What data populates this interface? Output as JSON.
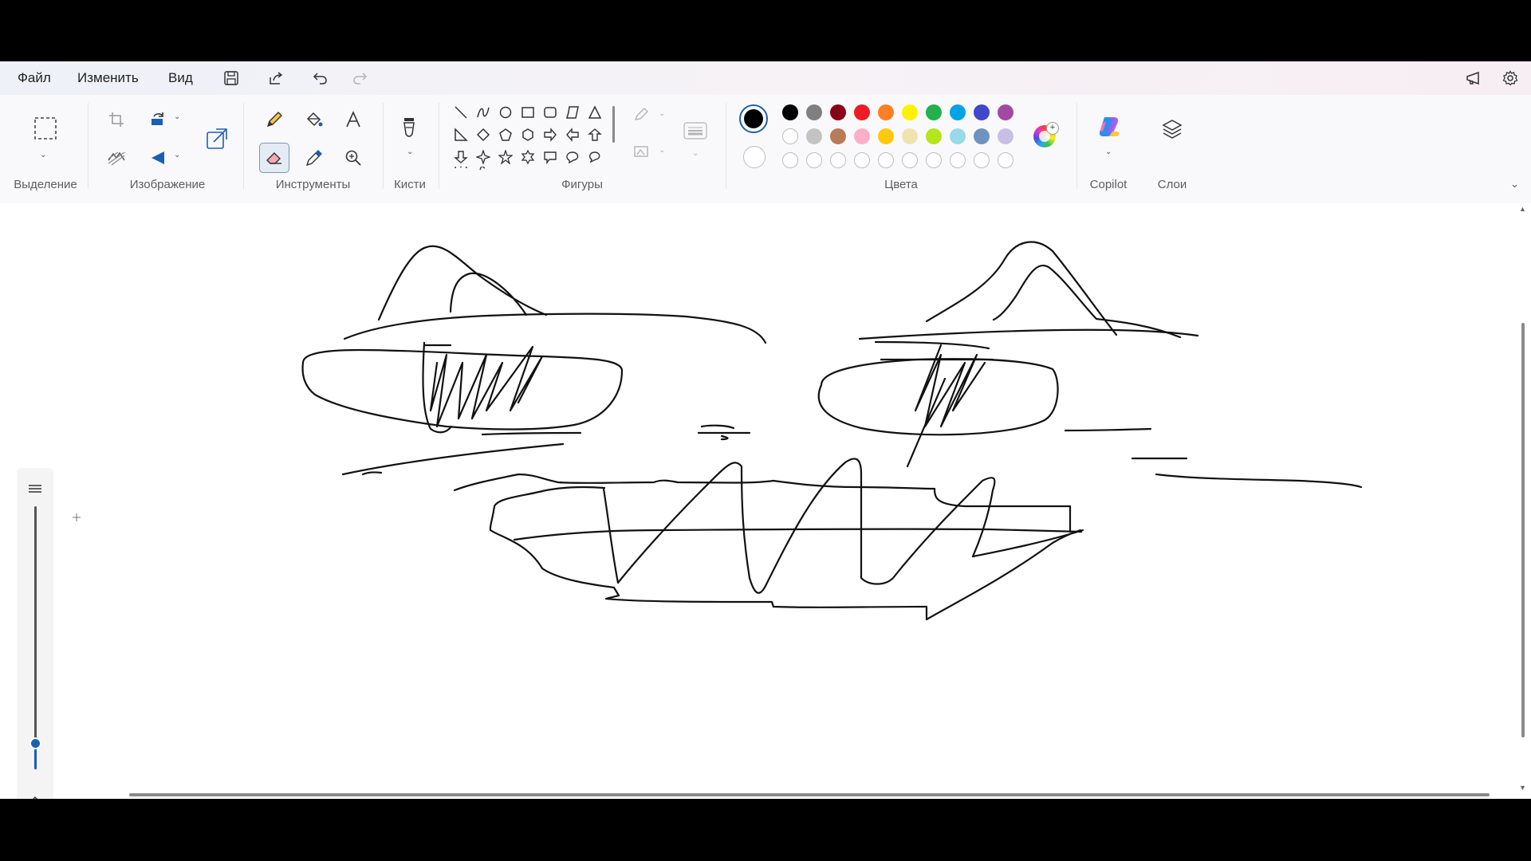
{
  "menu": {
    "file": "Файл",
    "edit": "Изменить",
    "view": "Вид"
  },
  "quick_access": {
    "save_icon": "save-icon",
    "share_icon": "share-icon",
    "undo_icon": "undo-icon",
    "redo_icon": "redo-icon",
    "announce_icon": "megaphone-icon",
    "settings_icon": "gear-icon"
  },
  "ribbon": {
    "groups": {
      "selection": "Выделение",
      "image": "Изображение",
      "tools": "Инструменты",
      "brushes": "Кисти",
      "shapes": "Фигуры",
      "colors": "Цвета",
      "copilot": "Copilot",
      "layers": "Слои"
    },
    "active_tool": "eraser"
  },
  "colors": {
    "primary": "#000000",
    "secondary": "#ffffff",
    "row1": [
      "#000000",
      "#7f7f7f",
      "#880015",
      "#ed1c24",
      "#ff7f27",
      "#fff200",
      "#22b14c",
      "#00a2e8",
      "#3f48cc",
      "#a349a4"
    ],
    "row2": [
      "#ffffff",
      "#c3c3c3",
      "#b97a57",
      "#ffaec9",
      "#ffc90e",
      "#efe4b0",
      "#b5e61d",
      "#99d9ea",
      "#7092be",
      "#c8bfe7"
    ],
    "row3_empty_count": 10
  },
  "zoom_slider": {
    "level": 0.1
  }
}
